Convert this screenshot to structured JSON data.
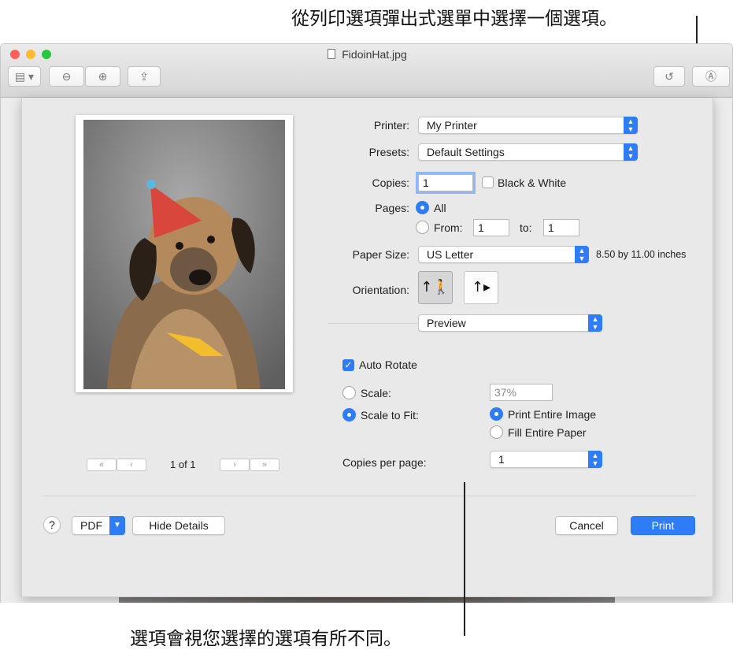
{
  "callouts": {
    "top": "從列印選項彈出式選單中選擇一個選項。",
    "bottom": "選項會視您選擇的選項有所不同。"
  },
  "window": {
    "title": "FidoinHat.jpg",
    "toolbar_icons": [
      "sidebar-icon",
      "zoom-out-icon",
      "zoom-in-icon",
      "share-icon",
      "rotate-icon",
      "markup-icon"
    ]
  },
  "preview": {
    "page_indicator": "1 of 1"
  },
  "print": {
    "printer_label": "Printer:",
    "printer_value": "My Printer",
    "presets_label": "Presets:",
    "presets_value": "Default Settings",
    "copies_label": "Copies:",
    "copies_value": "1",
    "bw_label": "Black & White",
    "pages_label": "Pages:",
    "pages_all": "All",
    "pages_from": "From:",
    "pages_from_value": "1",
    "pages_to": "to:",
    "pages_to_value": "1",
    "paper_size_label": "Paper Size:",
    "paper_size_value": "US Letter",
    "paper_size_dims": "8.50 by 11.00 inches",
    "orientation_label": "Orientation:",
    "options_menu_value": "Preview",
    "auto_rotate_label": "Auto Rotate",
    "scale_label": "Scale:",
    "scale_value": "37%",
    "scale_to_fit_label": "Scale to Fit:",
    "print_entire_image": "Print Entire Image",
    "fill_entire_paper": "Fill Entire Paper",
    "copies_per_page_label": "Copies per page:",
    "copies_per_page_value": "1",
    "help": "?",
    "pdf": "PDF",
    "hide_details": "Hide Details",
    "cancel": "Cancel",
    "print_button": "Print"
  },
  "colors": {
    "accent": "#2e7cf6",
    "close": "#fe5f57",
    "minimize": "#febc2e",
    "zoom": "#28c840"
  }
}
